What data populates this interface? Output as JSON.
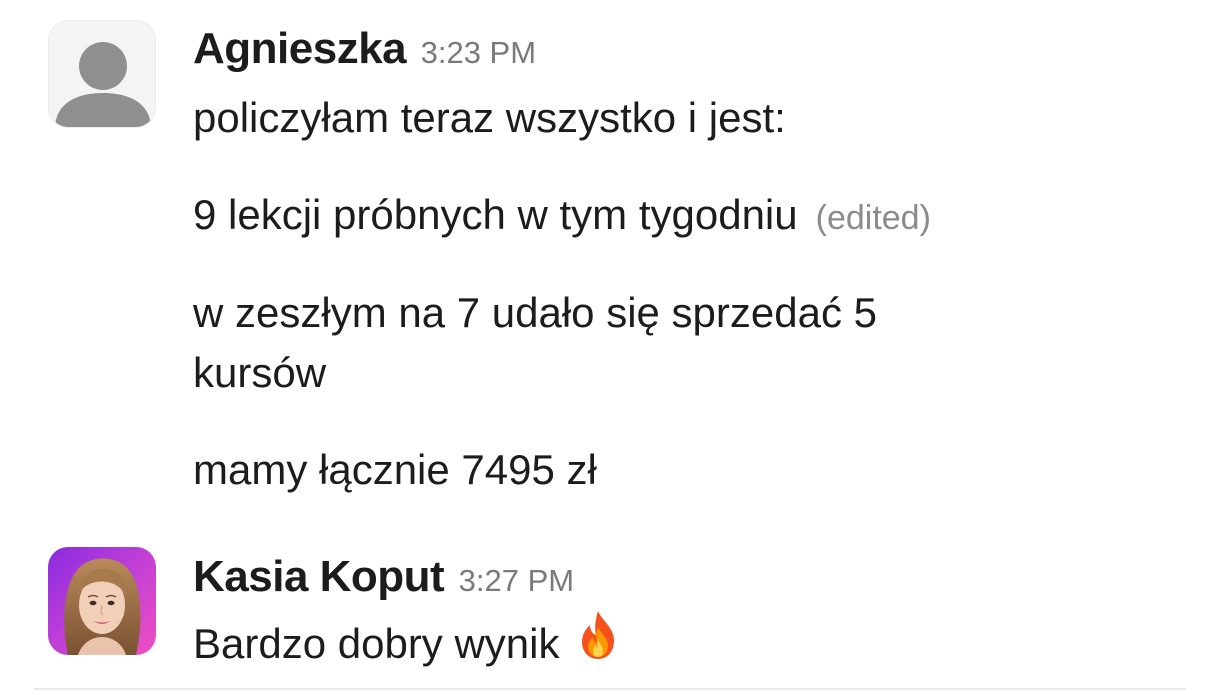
{
  "messages": [
    {
      "author": "Agnieszka",
      "time": "3:23 PM",
      "avatar": "default-user-icon",
      "lines": [
        "policzyłam teraz wszystko i jest:",
        "9 lekcji próbnych w tym tygodniu",
        "w zeszłym na 7 udało się sprzedać 5",
        "kursów",
        "mamy łącznie 7495 zł"
      ],
      "edited_label": "(edited)"
    },
    {
      "author": "Kasia Koput",
      "time": "3:27 PM",
      "avatar": "user-photo",
      "text": "Bardzo dobry wynik",
      "emoji": "fire-icon"
    }
  ],
  "colors": {
    "text": "#1d1c1d",
    "timestamp": "#7a7a7a",
    "edited": "#8b8b8b",
    "avatar_gradient_start": "#8a2be2",
    "avatar_gradient_end": "#ee4fc0"
  }
}
